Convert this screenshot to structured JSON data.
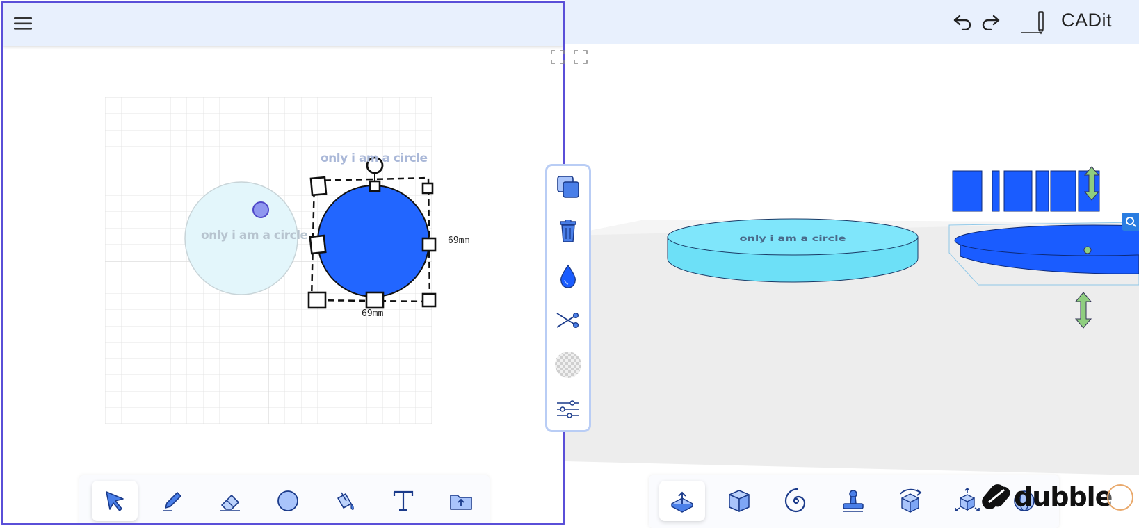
{
  "app": {
    "title": "CADit",
    "brand": "dubble"
  },
  "canvas2d": {
    "label_ghost": "only i am a circle",
    "label_selected": "only i am a circle",
    "width_label": "69mm",
    "height_label": "69mm"
  },
  "scene3d": {
    "engraved_text": "only i am a circle"
  },
  "left_toolbar": [
    "select",
    "pencil",
    "eraser",
    "circle",
    "paint-bucket",
    "text",
    "open-folder"
  ],
  "side_tools": [
    "duplicate",
    "delete",
    "color",
    "cut",
    "transparency",
    "settings"
  ],
  "right_toolbar": [
    "export",
    "extrude",
    "spiral",
    "stamp",
    "rotate",
    "expand",
    "globe"
  ],
  "colors": {
    "accent": "#5a4fd8",
    "shape_fill": "#2266ff",
    "ghost_fill": "#e3f6fb",
    "disc_light": "#6de0f7",
    "disc_dark": "#1a5cff",
    "topbar": "#e8f0fd",
    "floor": "#ededed"
  }
}
